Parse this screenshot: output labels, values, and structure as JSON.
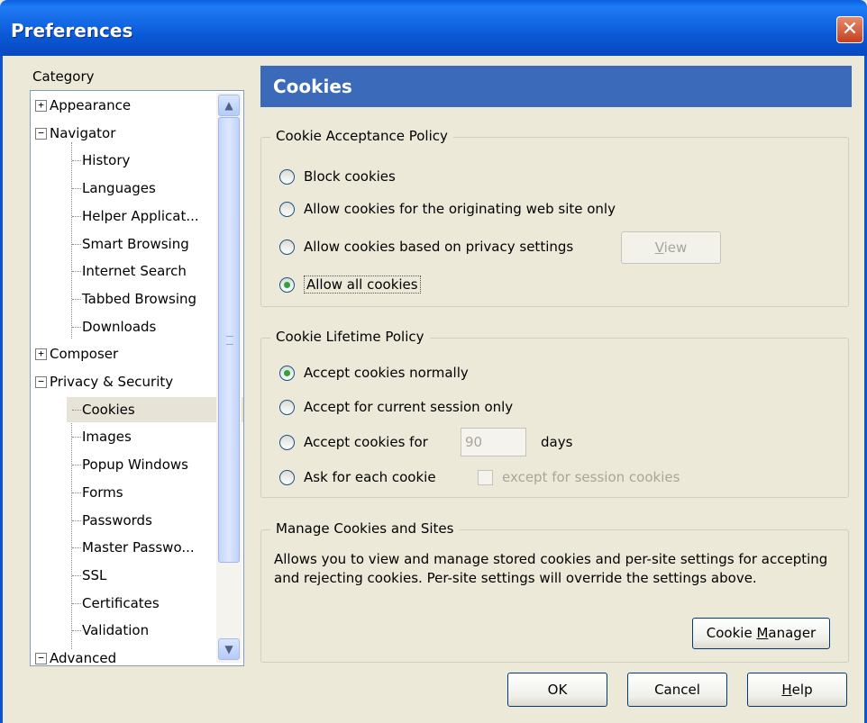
{
  "window": {
    "title": "Preferences",
    "close_glyph": "✕"
  },
  "sidebar": {
    "category_label": "Category",
    "items": [
      {
        "label": "Appearance",
        "expander": "+"
      },
      {
        "label": "Navigator",
        "expander": "−"
      },
      {
        "label": "History"
      },
      {
        "label": "Languages"
      },
      {
        "label": "Helper Applicat..."
      },
      {
        "label": "Smart Browsing"
      },
      {
        "label": "Internet Search"
      },
      {
        "label": "Tabbed Browsing"
      },
      {
        "label": "Downloads"
      },
      {
        "label": "Composer",
        "expander": "+"
      },
      {
        "label": "Privacy & Security",
        "expander": "−"
      },
      {
        "label": "Cookies",
        "selected": true
      },
      {
        "label": "Images"
      },
      {
        "label": "Popup Windows"
      },
      {
        "label": "Forms"
      },
      {
        "label": "Passwords"
      },
      {
        "label": "Master Passwo..."
      },
      {
        "label": "SSL"
      },
      {
        "label": "Certificates"
      },
      {
        "label": "Validation"
      },
      {
        "label": "Advanced",
        "expander": "−"
      }
    ],
    "scroll_up_glyph": "▲",
    "scroll_down_glyph": "▼"
  },
  "panel": {
    "title": "Cookies",
    "acceptance": {
      "legend": "Cookie Acceptance Policy",
      "options": [
        {
          "label": "Block cookies",
          "checked": false
        },
        {
          "label": "Allow cookies for the originating web site only",
          "checked": false
        },
        {
          "label": "Allow cookies based on privacy settings",
          "checked": false
        },
        {
          "label": "Allow all cookies",
          "checked": true
        }
      ],
      "view_button": {
        "prefix": "",
        "underlined": "V",
        "suffix": "iew"
      }
    },
    "lifetime": {
      "legend": "Cookie Lifetime Policy",
      "options": [
        {
          "label": "Accept cookies normally",
          "checked": true
        },
        {
          "label": "Accept for current session only",
          "checked": false
        },
        {
          "label": "Accept cookies for",
          "checked": false
        },
        {
          "label": "Ask for each cookie",
          "checked": false
        }
      ],
      "days_value": "90",
      "days_label": "days",
      "except_label": "except for session cookies"
    },
    "manage": {
      "legend": "Manage Cookies and Sites",
      "description": "Allows you to view and manage stored cookies and per-site settings for accepting and rejecting cookies. Per-site settings will override the settings above.",
      "button": {
        "prefix": "Cookie ",
        "underlined": "M",
        "suffix": "anager"
      }
    }
  },
  "footer": {
    "ok": "OK",
    "cancel": "Cancel",
    "help": {
      "prefix": "",
      "underlined": "H",
      "suffix": "elp"
    }
  },
  "colors": {
    "titlebar": "#0b5bd8",
    "panel_header": "#3a6ab9",
    "dialog_bg": "#ece9d8",
    "radio_dot": "#2fa33b"
  }
}
